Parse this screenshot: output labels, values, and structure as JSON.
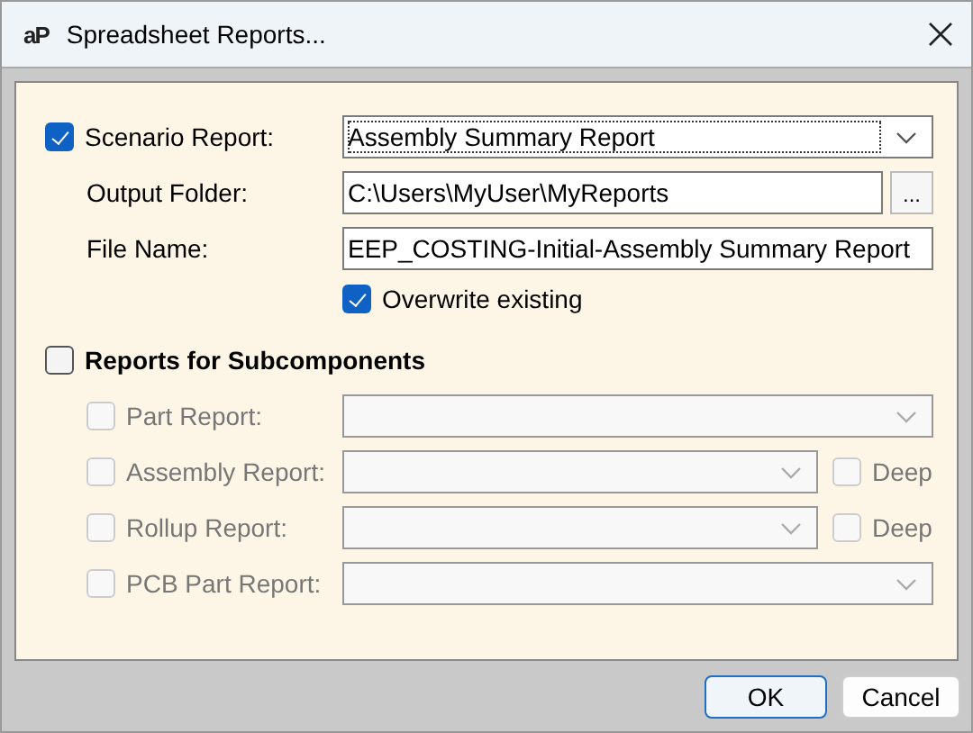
{
  "window": {
    "logo": "aP",
    "title": "Spreadsheet Reports..."
  },
  "scenario_report": {
    "label": "Scenario Report:",
    "checked": true,
    "value": "Assembly Summary Report"
  },
  "output_folder": {
    "label": "Output Folder:",
    "value": "C:\\Users\\MyUser\\MyReports",
    "browse": "..."
  },
  "file_name": {
    "label": "File Name:",
    "value": "EEP_COSTING-Initial-Assembly Summary Report"
  },
  "overwrite": {
    "label": "Overwrite existing",
    "checked": true
  },
  "subcomponents": {
    "label": "Reports for Subcomponents",
    "checked": false,
    "reports": [
      {
        "label": "Part Report:",
        "checked": false,
        "disabled": true
      },
      {
        "label": "Assembly Report:",
        "checked": false,
        "disabled": true,
        "deep": {
          "label": "Deep",
          "checked": false
        }
      },
      {
        "label": "Rollup Report:",
        "checked": false,
        "disabled": true,
        "deep": {
          "label": "Deep",
          "checked": false
        }
      },
      {
        "label": "PCB Part Report:",
        "checked": false,
        "disabled": true
      }
    ]
  },
  "buttons": [
    {
      "label": "OK",
      "default": true
    },
    {
      "label": "Cancel",
      "default": false
    }
  ]
}
